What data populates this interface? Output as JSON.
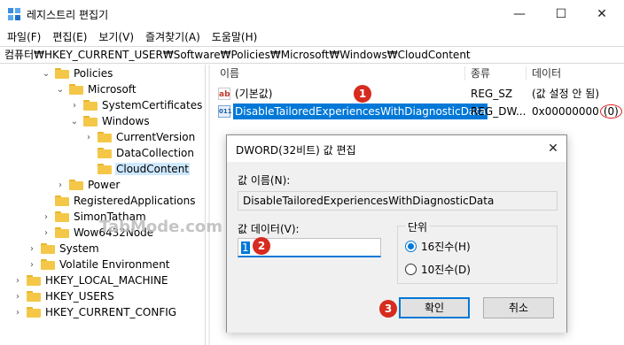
{
  "window": {
    "title": "레지스트리 편집기",
    "controls": {
      "minimize": "—",
      "maximize": "☐",
      "close": "✕"
    }
  },
  "menu": [
    "파일(F)",
    "편집(E)",
    "보기(V)",
    "즐겨찾기(A)",
    "도움말(H)"
  ],
  "address": "컴퓨터₩HKEY_CURRENT_USER₩Software₩Policies₩Microsoft₩Windows₩CloudContent",
  "tree": {
    "items": [
      {
        "label": "Policies",
        "chevron": "⌄"
      },
      {
        "label": "Microsoft",
        "chevron": "⌄"
      },
      {
        "label": "SystemCertificates",
        "chevron": "›"
      },
      {
        "label": "Windows",
        "chevron": "⌄"
      },
      {
        "label": "CurrentVersion",
        "chevron": "›"
      },
      {
        "label": "DataCollection",
        "chevron": ""
      },
      {
        "label": "CloudContent",
        "chevron": ""
      },
      {
        "label": "Power",
        "chevron": "›"
      },
      {
        "label": "RegisteredApplications",
        "chevron": ""
      },
      {
        "label": "SimonTatham",
        "chevron": "›"
      },
      {
        "label": "Wow6432Node",
        "chevron": "›"
      },
      {
        "label": "System",
        "chevron": "›"
      },
      {
        "label": "Volatile Environment",
        "chevron": "›"
      },
      {
        "label": "HKEY_LOCAL_MACHINE",
        "chevron": "›"
      },
      {
        "label": "HKEY_USERS",
        "chevron": "›"
      },
      {
        "label": "HKEY_CURRENT_CONFIG",
        "chevron": "›"
      }
    ]
  },
  "list": {
    "headers": {
      "name": "이름",
      "type": "종류",
      "data": "데이터"
    },
    "rows": [
      {
        "icon": "ab",
        "name": "(기본값)",
        "type": "REG_SZ",
        "data": "(값 설정 안 됨)",
        "data_suffix": ""
      },
      {
        "icon": "011",
        "name": "DisableTailoredExperiencesWithDiagnosticData",
        "type": "REG_DW...",
        "data": "0x00000000",
        "data_suffix": "(0)"
      }
    ]
  },
  "badges": {
    "one": "1",
    "two": "2",
    "three": "3"
  },
  "dialog": {
    "title": "DWORD(32비트) 값 편집",
    "close": "✕",
    "name_label": "값 이름(N):",
    "name_value": "DisableTailoredExperiencesWithDiagnosticData",
    "data_label": "값 데이터(V):",
    "data_value": "1",
    "base_label": "단위",
    "hex_label": "16진수(H)",
    "dec_label": "10진수(D)",
    "selected_base": "hex",
    "ok": "확인",
    "cancel": "취소"
  },
  "watermark": "TabMode.com",
  "colors": {
    "selection": "#0078d7",
    "badge": "#d62b1f",
    "folder": "#f5c748"
  }
}
